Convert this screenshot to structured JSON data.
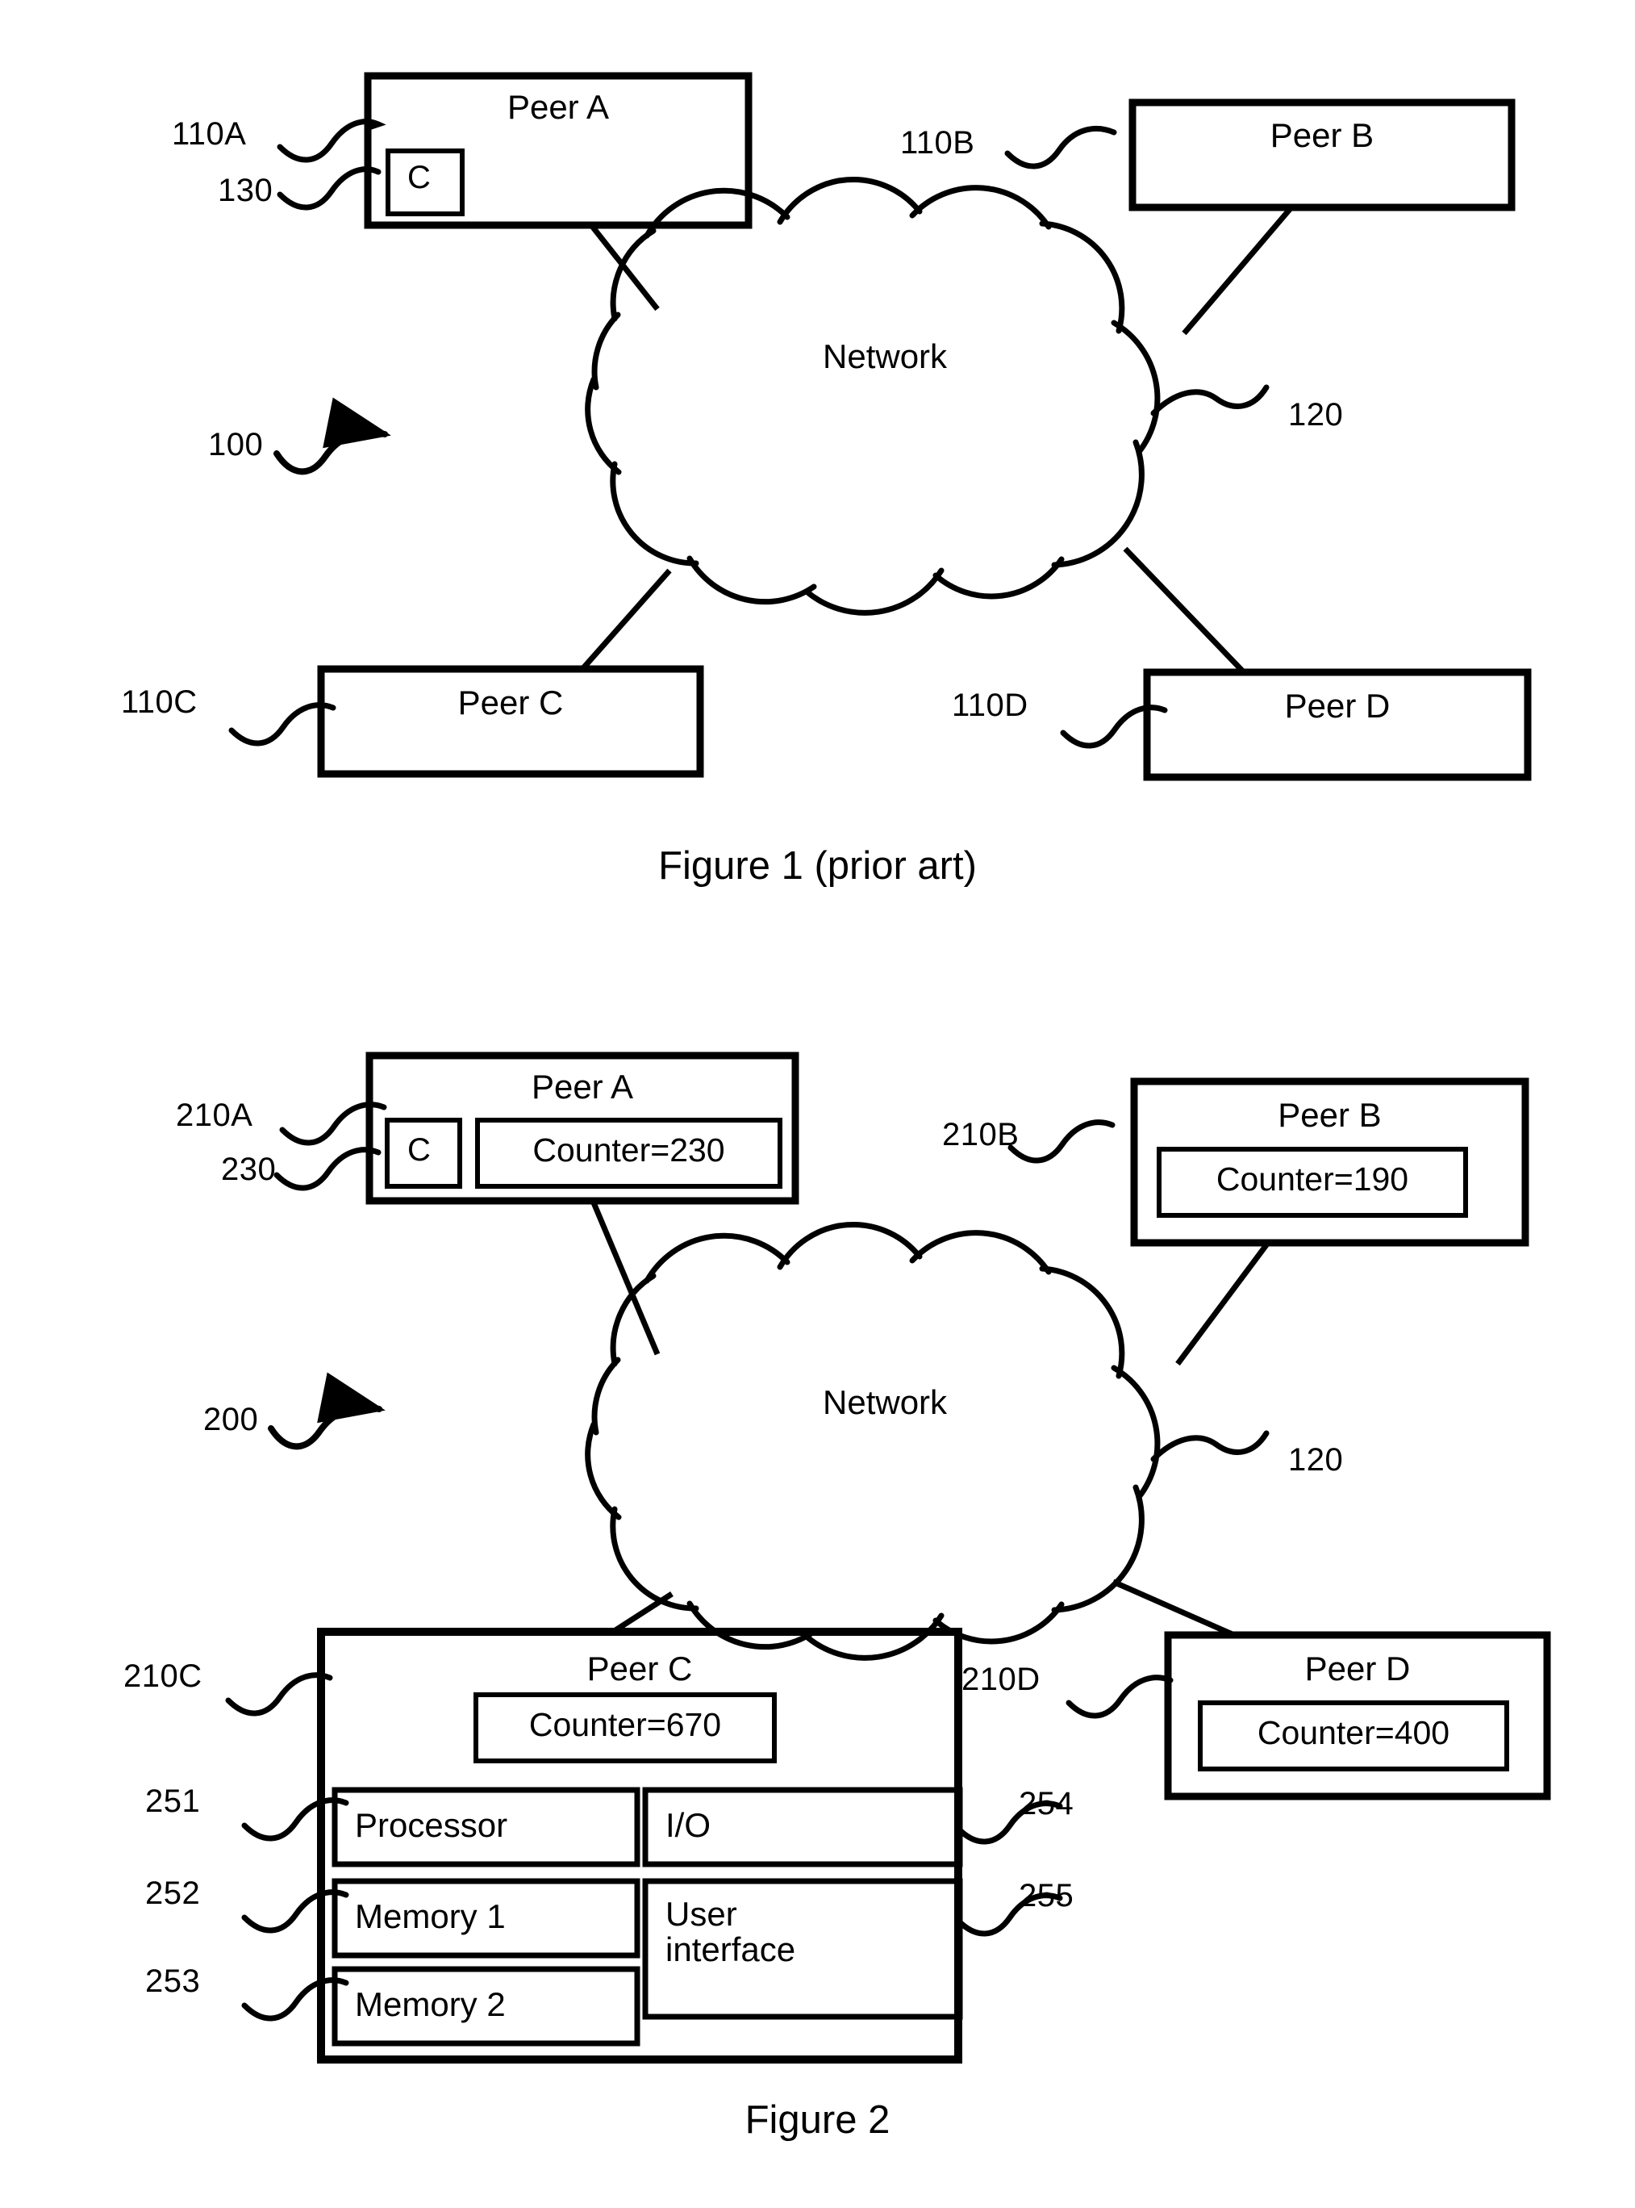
{
  "figures": [
    {
      "id": "figure-1",
      "caption": "Figure 1 (prior art)",
      "system_ref": "100",
      "cloud_label": "Network",
      "cloud_ref": "120",
      "peers": [
        {
          "name": "Peer A",
          "ref": "110A",
          "inner_ref": "130",
          "inner_letter": "C"
        },
        {
          "name": "Peer B",
          "ref": "110B"
        },
        {
          "name": "Peer C",
          "ref": "110C"
        },
        {
          "name": "Peer D",
          "ref": "110D"
        }
      ]
    },
    {
      "id": "figure-2",
      "caption": "Figure 2",
      "system_ref": "200",
      "cloud_label": "Network",
      "cloud_ref": "120",
      "peers": [
        {
          "name": "Peer A",
          "ref": "210A",
          "inner_ref": "230",
          "inner_letter": "C",
          "counter": "Counter=230"
        },
        {
          "name": "Peer B",
          "ref": "210B",
          "counter": "Counter=190"
        },
        {
          "name": "Peer C",
          "ref": "210C",
          "counter": "Counter=670",
          "components": [
            {
              "label": "Processor",
              "ref": "251"
            },
            {
              "label": "Memory 1",
              "ref": "252"
            },
            {
              "label": "Memory 2",
              "ref": "253"
            },
            {
              "label": "I/O",
              "ref": "254"
            },
            {
              "label": "User\ninterface",
              "ref": "255"
            }
          ]
        },
        {
          "name": "Peer D",
          "ref": "210D",
          "counter": "Counter=400"
        }
      ]
    }
  ],
  "colors": {
    "ink": "#000000",
    "paper": "#ffffff"
  }
}
